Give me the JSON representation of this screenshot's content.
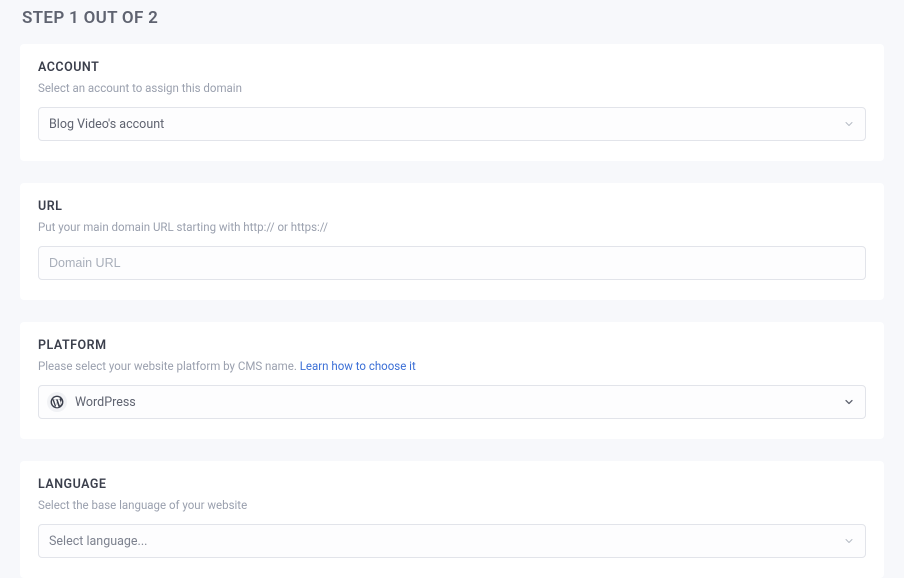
{
  "stepTitle": "STEP 1 OUT OF 2",
  "account": {
    "label": "ACCOUNT",
    "desc": "Select an account to assign this domain",
    "value": "Blog Video's account"
  },
  "url": {
    "label": "URL",
    "desc": "Put your main domain URL starting with http:// or https://",
    "placeholder": "Domain URL"
  },
  "platform": {
    "label": "PLATFORM",
    "descPrefix": "Please select your website platform by CMS name.  ",
    "linkText": "Learn how to choose it",
    "value": "WordPress",
    "icon": "wordpress-icon"
  },
  "language": {
    "label": "LANGUAGE",
    "desc": "Select the base language of your website",
    "placeholder": "Select language..."
  }
}
